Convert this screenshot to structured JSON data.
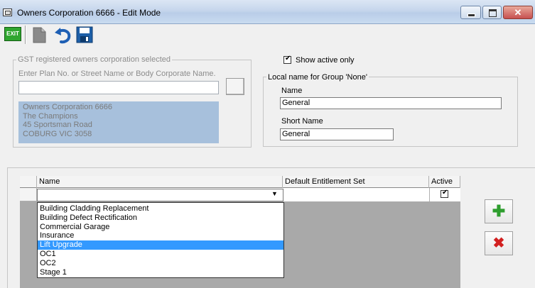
{
  "window": {
    "title": "Owners Corporation 6666 - Edit Mode",
    "minimize_icon": "minimize-icon",
    "maximize_icon": "maximize-icon",
    "close_icon": "close-icon",
    "close_glyph": "✕"
  },
  "toolbar": {
    "exit_label": "EXIT",
    "icons": [
      "exit-icon",
      "new-document-icon",
      "undo-icon",
      "save-icon"
    ]
  },
  "gst_group": {
    "legend": "GST registered owners corporation selected",
    "prompt": "Enter Plan No. or Street Name or Body Corporate Name.",
    "search_value": "",
    "address": [
      "Owners Corporation 6666",
      "The Champions",
      "45 Sportsman Road",
      "COBURG  VIC  3058"
    ]
  },
  "show_active_only": {
    "label": "Show active only",
    "checked": true
  },
  "local_group": {
    "legend": "Local name for Group 'None'",
    "name_label": "Name",
    "name_value": "General",
    "short_name_label": "Short Name",
    "short_name_value": "General"
  },
  "grid": {
    "columns": [
      "Name",
      "Default Entitlement Set",
      "Active"
    ],
    "current_row": {
      "name": "",
      "entitlement": "",
      "active": true
    }
  },
  "name_dropdown": {
    "options": [
      "Building Cladding Replacement",
      "Building Defect Rectification",
      "Commercial Garage",
      "Insurance",
      "Lift Upgrade",
      "OC1",
      "OC2",
      "Stage 1"
    ],
    "highlighted": "Lift Upgrade"
  },
  "side_buttons": {
    "add_glyph": "✚",
    "delete_glyph": "✖"
  },
  "colors": {
    "address_panel": "#a7c0dc",
    "selection": "#3399ff",
    "grid_background": "#a9a9a9"
  }
}
